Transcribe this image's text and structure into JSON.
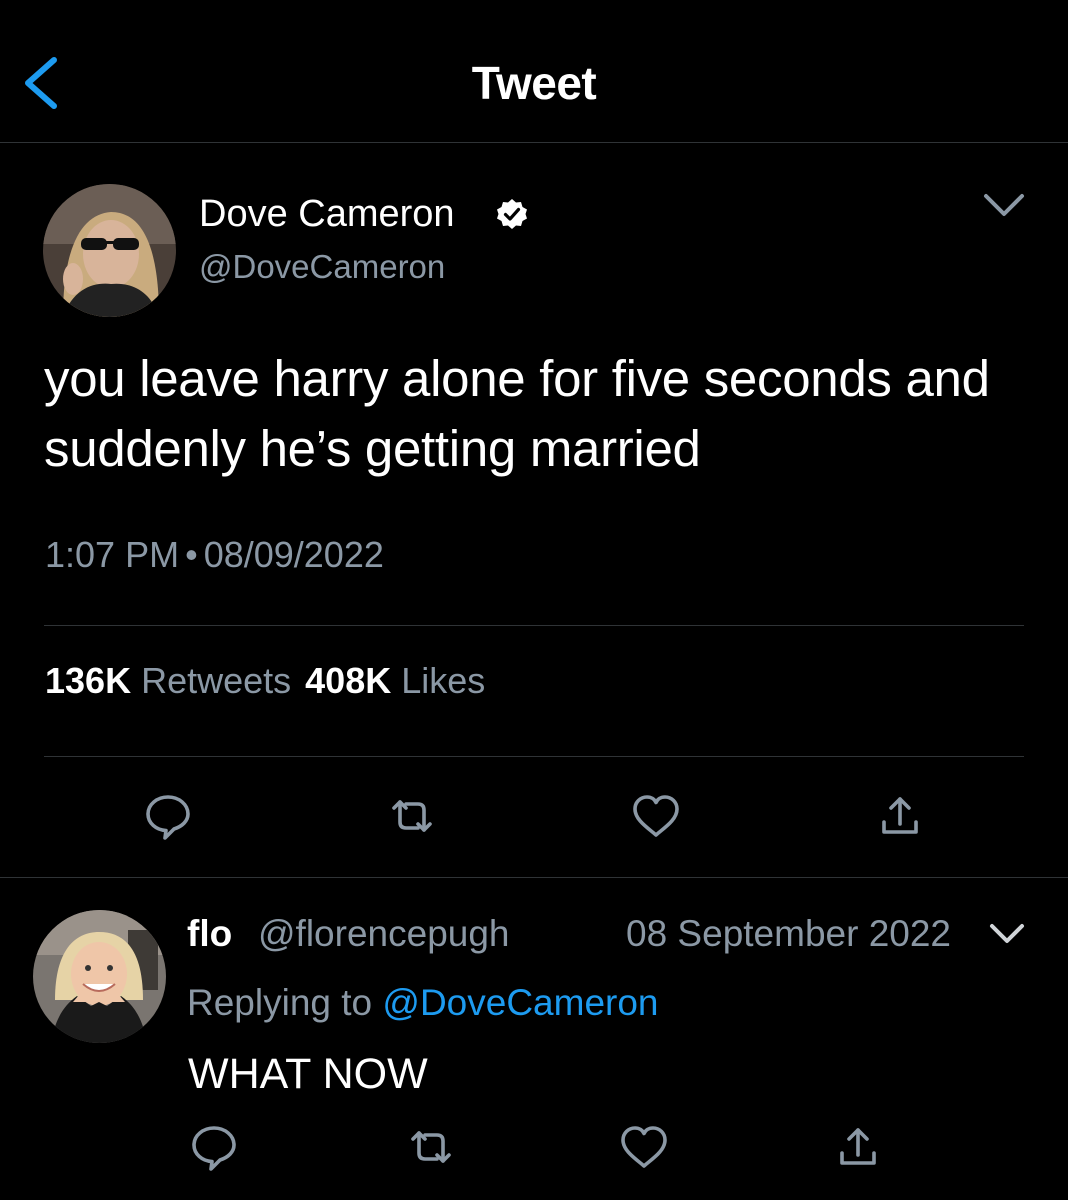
{
  "header": {
    "title": "Tweet",
    "back_icon": "chevron-left-icon",
    "accent_color": "#1d9bf0"
  },
  "tweet": {
    "author_name": "Dove Cameron",
    "author_handle": "@DoveCameron",
    "verified": true,
    "text": "you leave harry alone for five seconds and suddenly he’s getting married",
    "time": "1:07 PM",
    "separator": "•",
    "date": "08/09/2022",
    "stats": {
      "retweets_count": "136K",
      "retweets_label": "Retweets",
      "likes_count": "408K",
      "likes_label": "Likes"
    },
    "actions": [
      "reply-icon",
      "retweet-icon",
      "like-icon",
      "share-icon"
    ]
  },
  "reply": {
    "author_name": "flo",
    "author_handle": "@florencepugh",
    "date": "08 September 2022",
    "replying_prefix": "Replying to",
    "replying_to": "@DoveCameron",
    "text": "WHAT NOW",
    "actions": [
      "reply-icon",
      "retweet-icon",
      "like-icon",
      "share-icon"
    ]
  },
  "colors": {
    "background": "#000000",
    "text": "#ffffff",
    "secondary_text": "#8b98a5",
    "link": "#1d9bf0",
    "divider": "#2f3336"
  }
}
